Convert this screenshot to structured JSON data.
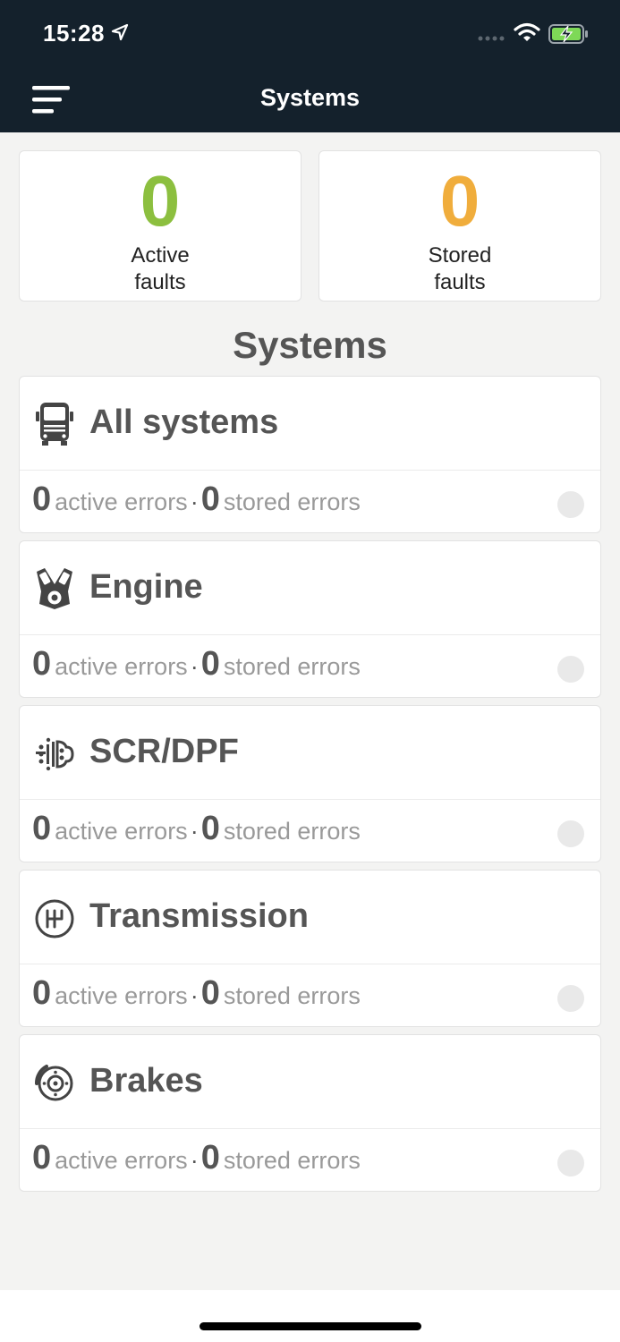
{
  "status_bar": {
    "time": "15:28",
    "icons": [
      "location-arrow-icon",
      "signal-dots-icon",
      "wifi-icon",
      "battery-charging-icon"
    ]
  },
  "nav": {
    "title": "Systems",
    "menu_icon": "menu-icon"
  },
  "summary": {
    "active": {
      "count": "0",
      "label": "Active faults",
      "color": "#8cbf3f"
    },
    "stored": {
      "count": "0",
      "label": "Stored faults",
      "color": "#f0ad3c"
    }
  },
  "section_title": "Systems",
  "systems": [
    {
      "name": "All systems",
      "icon": "truck-icon",
      "active": "0",
      "active_label": "active errors",
      "sep": "·",
      "stored": "0",
      "stored_label": "stored errors"
    },
    {
      "name": "Engine",
      "icon": "engine-icon",
      "active": "0",
      "active_label": "active errors",
      "sep": "·",
      "stored": "0",
      "stored_label": "stored errors"
    },
    {
      "name": "SCR/DPF",
      "icon": "exhaust-icon",
      "active": "0",
      "active_label": "active errors",
      "sep": "·",
      "stored": "0",
      "stored_label": "stored errors"
    },
    {
      "name": "Transmission",
      "icon": "gear-shift-icon",
      "active": "0",
      "active_label": "active errors",
      "sep": "·",
      "stored": "0",
      "stored_label": "stored errors"
    },
    {
      "name": "Brakes",
      "icon": "brake-disc-icon",
      "active": "0",
      "active_label": "active errors",
      "sep": "·",
      "stored": "0",
      "stored_label": "stored errors"
    }
  ],
  "colors": {
    "header_bg": "#14212c",
    "indicator_off": "#e9e9e9"
  }
}
